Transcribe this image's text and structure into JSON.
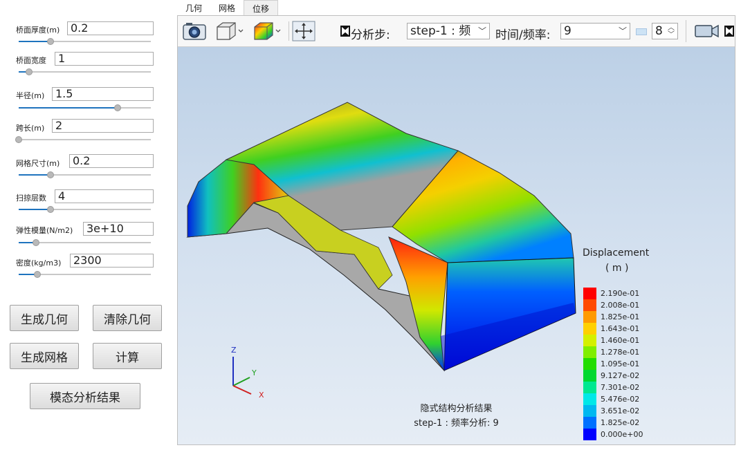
{
  "params": [
    {
      "label": "桥面厚度(m)",
      "value": "0.2",
      "slider": 0.24
    },
    {
      "label": "桥面宽度",
      "value": "1",
      "slider": 0.08
    },
    {
      "label": "半径(m)",
      "value": "1.5",
      "slider": 0.75
    },
    {
      "label": "跨长(m)",
      "value": "2",
      "slider": 0.0
    },
    {
      "label": "网格尺寸(m)",
      "value": "0.2",
      "slider": 0.24
    },
    {
      "label": "扫掠层数",
      "value": "4",
      "slider": 0.24
    },
    {
      "label": "弹性模量(N/m2)",
      "value": "3e+10",
      "slider": 0.13
    },
    {
      "label": "密度(kg/m3)",
      "value": "2300",
      "slider": 0.14
    }
  ],
  "buttons": {
    "gen_geometry": "生成几何",
    "clear_geometry": "清除几何",
    "gen_mesh": "生成网格",
    "compute": "计算",
    "modal_result": "模态分析结果"
  },
  "tabs": [
    "几何",
    "网格",
    "位移"
  ],
  "active_tab": "位移",
  "toolbar": {
    "step_label": "分析步:",
    "step_value": "step-1 : 频",
    "time_label": "时间/频率:",
    "time_value": "9",
    "spin_value": "8"
  },
  "legend": {
    "title": "Displacement",
    "unit": "( m )",
    "values": [
      "2.190e-01",
      "2.008e-01",
      "1.825e-01",
      "1.643e-01",
      "1.460e-01",
      "1.278e-01",
      "1.095e-01",
      "9.127e-02",
      "7.301e-02",
      "5.476e-02",
      "3.651e-02",
      "1.825e-02",
      "0.000e+00"
    ],
    "colors": [
      "#ff0000",
      "#ff4a00",
      "#ff9a00",
      "#ffd000",
      "#d4f000",
      "#80ee00",
      "#22dd00",
      "#00d830",
      "#00e890",
      "#00e8e8",
      "#00b8f0",
      "#0070ff",
      "#0000ff"
    ]
  },
  "triad": {
    "z": "Z",
    "y": "Y",
    "x": "X"
  },
  "caption": {
    "line1": "隐式结构分析结果",
    "line2": "step-1 : 频率分析: 9"
  }
}
